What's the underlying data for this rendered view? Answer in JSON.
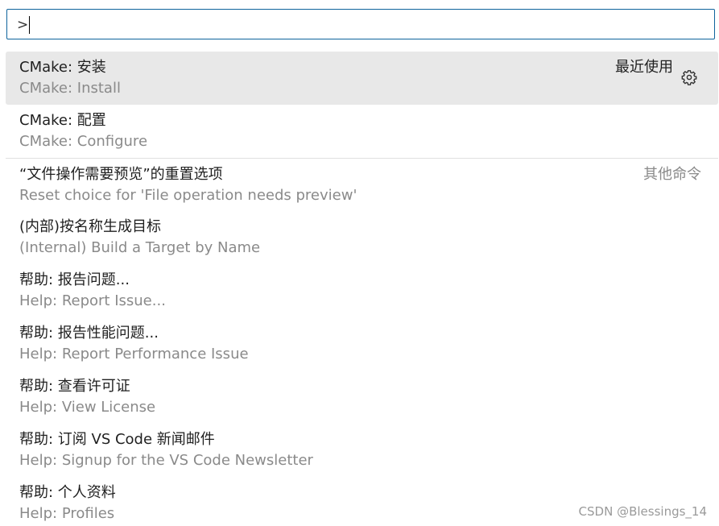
{
  "input": {
    "value": ">"
  },
  "items": [
    {
      "title": "CMake: 安装",
      "subtitle": "CMake: Install",
      "group": "最近使用"
    },
    {
      "title": "CMake: 配置",
      "subtitle": "CMake: Configure"
    },
    {
      "title": "“文件操作需要预览”的重置选项",
      "subtitle": "Reset choice for 'File operation needs preview'",
      "group": "其他命令"
    },
    {
      "title": "(内部)按名称生成目标",
      "subtitle": "(Internal) Build a Target by Name"
    },
    {
      "title": "帮助: 报告问题...",
      "subtitle": "Help: Report Issue..."
    },
    {
      "title": "帮助: 报告性能问题...",
      "subtitle": "Help: Report Performance Issue"
    },
    {
      "title": "帮助: 查看许可证",
      "subtitle": "Help: View License"
    },
    {
      "title": "帮助: 订阅 VS Code 新闻邮件",
      "subtitle": "Help: Signup for the VS Code Newsletter"
    },
    {
      "title": "帮助: 个人资料",
      "subtitle": "Help: Profiles"
    }
  ],
  "watermark": "CSDN @Blessings_14",
  "colors": {
    "input_border": "#0e639c",
    "selected_bg": "#e8e8e8",
    "subtitle_text": "#8a8a8a"
  },
  "icons": {
    "configure": "gear-icon"
  }
}
